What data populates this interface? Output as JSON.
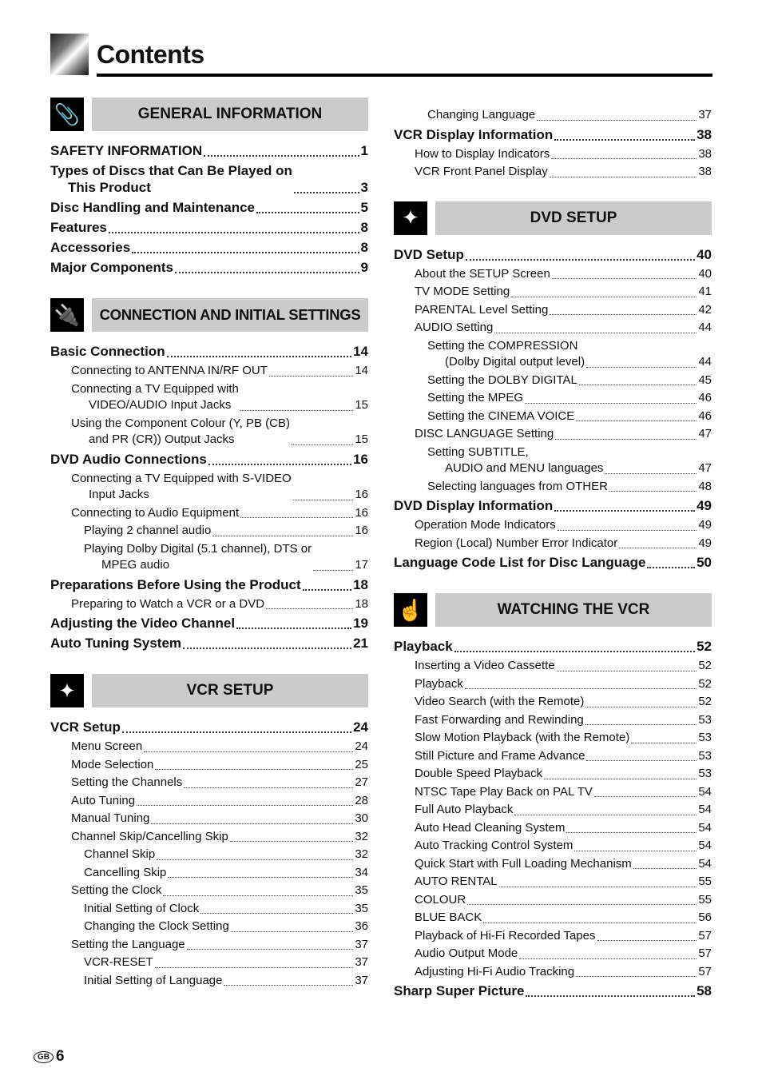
{
  "page": {
    "title": "Contents",
    "region_badge": "GB",
    "page_number": "6"
  },
  "sections": [
    {
      "id": "general",
      "heading": "GENERAL INFORMATION",
      "icon": "paperclip-icon",
      "column": "left",
      "entries": [
        {
          "level": 0,
          "text": "SAFETY INFORMATION",
          "page": "1"
        },
        {
          "level": 0,
          "text": "Types of Discs that Can Be Played on\nThis Product",
          "page": "3"
        },
        {
          "level": 0,
          "text": "Disc Handling and Maintenance",
          "page": "5"
        },
        {
          "level": 0,
          "text": "Features",
          "page": "8"
        },
        {
          "level": 0,
          "text": "Accessories",
          "page": "8"
        },
        {
          "level": 0,
          "text": "Major Components",
          "page": "9"
        }
      ]
    },
    {
      "id": "connection",
      "heading": "CONNECTION AND INITIAL SETTINGS",
      "icon": "cable-plug-icon",
      "column": "left",
      "entries": [
        {
          "level": 0,
          "text": "Basic Connection",
          "page": "14"
        },
        {
          "level": 1,
          "text": "Connecting to ANTENNA IN/RF OUT",
          "page": "14"
        },
        {
          "level": 1,
          "text": "Connecting a TV Equipped with\nVIDEO/AUDIO Input Jacks",
          "page": "15"
        },
        {
          "level": 1,
          "text": "Using the Component Colour (Y, PB (CB)\nand PR (CR)) Output Jacks",
          "page": "15"
        },
        {
          "level": 0,
          "text": "DVD Audio Connections",
          "page": "16"
        },
        {
          "level": 1,
          "text": "Connecting a TV Equipped with S-VIDEO\nInput Jacks",
          "page": "16"
        },
        {
          "level": 1,
          "text": "Connecting to Audio Equipment",
          "page": "16"
        },
        {
          "level": 2,
          "text": "Playing 2 channel audio",
          "page": "16"
        },
        {
          "level": 2,
          "text": "Playing Dolby Digital (5.1 channel), DTS or\nMPEG audio",
          "page": "17"
        },
        {
          "level": 0,
          "text": "Preparations Before Using the Product",
          "page": "18"
        },
        {
          "level": 1,
          "text": "Preparing to Watch a VCR or a DVD",
          "page": "18"
        },
        {
          "level": 0,
          "text": "Adjusting the Video Channel",
          "page": "19"
        },
        {
          "level": 0,
          "text": "Auto Tuning System",
          "page": "21"
        }
      ]
    },
    {
      "id": "vcr-setup",
      "heading": "VCR SETUP",
      "icon": "sparkle-hand-icon",
      "column": "left",
      "entries": [
        {
          "level": 0,
          "text": "VCR Setup",
          "page": "24"
        },
        {
          "level": 1,
          "text": "Menu Screen",
          "page": "24"
        },
        {
          "level": 1,
          "text": "Mode Selection",
          "page": "25"
        },
        {
          "level": 1,
          "text": "Setting the Channels",
          "page": "27"
        },
        {
          "level": 1,
          "text": "Auto Tuning",
          "page": "28"
        },
        {
          "level": 1,
          "text": "Manual Tuning",
          "page": "30"
        },
        {
          "level": 1,
          "text": "Channel Skip/Cancelling Skip",
          "page": "32"
        },
        {
          "level": 2,
          "text": "Channel Skip",
          "page": "32"
        },
        {
          "level": 2,
          "text": "Cancelling Skip",
          "page": "34"
        },
        {
          "level": 1,
          "text": "Setting the Clock",
          "page": "35"
        },
        {
          "level": 2,
          "text": "Initial Setting of Clock",
          "page": "35"
        },
        {
          "level": 2,
          "text": "Changing the Clock Setting",
          "page": "36"
        },
        {
          "level": 1,
          "text": "Setting the Language",
          "page": "37"
        },
        {
          "level": 2,
          "text": "VCR-RESET",
          "page": "37"
        },
        {
          "level": 2,
          "text": "Initial Setting of Language",
          "page": "37"
        }
      ]
    },
    {
      "id": "vcr-setup-cont",
      "heading": "",
      "icon": "",
      "column": "right",
      "entries": [
        {
          "level": 2,
          "text": "Changing Language",
          "page": "37"
        },
        {
          "level": 0,
          "text": "VCR Display Information",
          "page": "38"
        },
        {
          "level": 1,
          "text": "How to Display Indicators",
          "page": "38"
        },
        {
          "level": 1,
          "text": "VCR Front Panel Display",
          "page": "38"
        }
      ]
    },
    {
      "id": "dvd-setup",
      "heading": "DVD SETUP",
      "icon": "sparkle-hand-icon",
      "column": "right",
      "entries": [
        {
          "level": 0,
          "text": "DVD Setup",
          "page": "40"
        },
        {
          "level": 1,
          "text": "About the SETUP Screen",
          "page": "40"
        },
        {
          "level": 1,
          "text": "TV MODE Setting",
          "page": "41"
        },
        {
          "level": 1,
          "text": "PARENTAL Level Setting",
          "page": "42"
        },
        {
          "level": 1,
          "text": "AUDIO Setting",
          "page": "44"
        },
        {
          "level": 2,
          "text": "Setting the COMPRESSION\n(Dolby Digital output level)",
          "page": "44"
        },
        {
          "level": 2,
          "text": "Setting the DOLBY DIGITAL",
          "page": "45"
        },
        {
          "level": 2,
          "text": "Setting the MPEG",
          "page": "46"
        },
        {
          "level": 2,
          "text": "Setting the CINEMA VOICE",
          "page": "46"
        },
        {
          "level": 1,
          "text": "DISC LANGUAGE Setting",
          "page": "47"
        },
        {
          "level": 2,
          "text": "Setting SUBTITLE,\nAUDIO and MENU languages",
          "page": "47"
        },
        {
          "level": 2,
          "text": "Selecting languages from OTHER",
          "page": "48"
        },
        {
          "level": 0,
          "text": "DVD Display Information",
          "page": "49"
        },
        {
          "level": 1,
          "text": "Operation Mode Indicators",
          "page": "49"
        },
        {
          "level": 1,
          "text": "Region (Local) Number Error Indicator",
          "page": "49"
        },
        {
          "level": 0,
          "text": "Language Code List for Disc Language",
          "page": "50"
        }
      ]
    },
    {
      "id": "watching-vcr",
      "heading": "WATCHING THE VCR",
      "icon": "finger-press-icon",
      "column": "right",
      "entries": [
        {
          "level": 0,
          "text": "Playback",
          "page": "52"
        },
        {
          "level": 1,
          "text": "Inserting a Video Cassette",
          "page": "52"
        },
        {
          "level": 1,
          "text": "Playback",
          "page": "52"
        },
        {
          "level": 1,
          "text": "Video Search (with the Remote)",
          "page": "52"
        },
        {
          "level": 1,
          "text": "Fast Forwarding and Rewinding",
          "page": "53"
        },
        {
          "level": 1,
          "text": "Slow Motion Playback (with the Remote)",
          "page": "53"
        },
        {
          "level": 1,
          "text": "Still Picture and Frame Advance",
          "page": "53"
        },
        {
          "level": 1,
          "text": "Double Speed Playback",
          "page": "53"
        },
        {
          "level": 1,
          "text": "NTSC Tape Play Back on PAL TV",
          "page": "54"
        },
        {
          "level": 1,
          "text": "Full Auto Playback",
          "page": "54"
        },
        {
          "level": 1,
          "text": "Auto Head Cleaning System",
          "page": "54"
        },
        {
          "level": 1,
          "text": "Auto Tracking Control System",
          "page": "54"
        },
        {
          "level": 1,
          "text": "Quick Start with Full Loading Mechanism",
          "page": "54"
        },
        {
          "level": 1,
          "text": "AUTO RENTAL",
          "page": "55"
        },
        {
          "level": 1,
          "text": "COLOUR",
          "page": "55"
        },
        {
          "level": 1,
          "text": "BLUE BACK",
          "page": "56"
        },
        {
          "level": 1,
          "text": "Playback of Hi-Fi Recorded Tapes",
          "page": "57"
        },
        {
          "level": 1,
          "text": "Audio Output Mode",
          "page": "57"
        },
        {
          "level": 1,
          "text": "Adjusting Hi-Fi Audio Tracking",
          "page": "57"
        },
        {
          "level": 0,
          "text": "Sharp Super Picture",
          "page": "58"
        }
      ]
    }
  ],
  "icon_glyphs": {
    "paperclip-icon": "📎",
    "cable-plug-icon": "🔌",
    "sparkle-hand-icon": "✦",
    "finger-press-icon": "☝"
  },
  "colors": {
    "banner_bg": "#cbcbcb",
    "text": "#111111",
    "icon_bg": "#000000"
  }
}
